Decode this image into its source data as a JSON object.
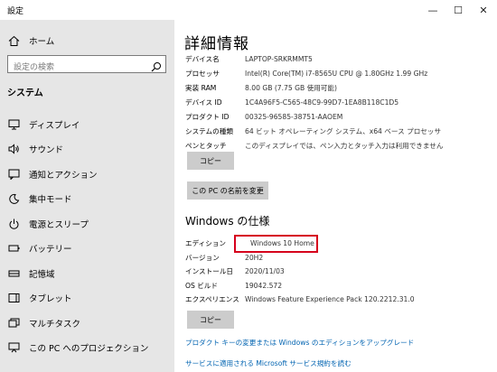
{
  "window": {
    "title": "設定",
    "minimize_glyph": "—",
    "maximize_glyph": "☐",
    "close_glyph": "✕"
  },
  "sidebar": {
    "home_label": "ホーム",
    "search_placeholder": "設定の検索",
    "section_title": "システム",
    "items": [
      {
        "label": "ディスプレイ",
        "icon": "display-icon"
      },
      {
        "label": "サウンド",
        "icon": "sound-icon"
      },
      {
        "label": "通知とアクション",
        "icon": "notification-icon"
      },
      {
        "label": "集中モード",
        "icon": "moon-icon"
      },
      {
        "label": "電源とスリープ",
        "icon": "power-icon"
      },
      {
        "label": "バッテリー",
        "icon": "battery-icon"
      },
      {
        "label": "記憶域",
        "icon": "storage-icon"
      },
      {
        "label": "タブレット",
        "icon": "tablet-icon"
      },
      {
        "label": "マルチタスク",
        "icon": "multitask-icon"
      },
      {
        "label": "この PC へのプロジェクション",
        "icon": "projection-icon"
      }
    ]
  },
  "main": {
    "title": "詳細情報",
    "device_specs": [
      {
        "label": "デバイス名",
        "value": "LAPTOP-SRKRMMT5"
      },
      {
        "label": "プロセッサ",
        "value": "Intel(R) Core(TM) i7-8565U CPU @ 1.80GHz   1.99 GHz"
      },
      {
        "label": "実装 RAM",
        "value": "8.00 GB (7.75 GB 使用可能)"
      },
      {
        "label": "デバイス ID",
        "value": "1C4A96F5-C565-48C9-99D7-1EA8B118C1D5"
      },
      {
        "label": "プロダクト ID",
        "value": "00325-96585-38751-AAOEM"
      },
      {
        "label": "システムの種類",
        "value": "64 ビット オペレーティング システム、x64 ベース プロセッサ"
      },
      {
        "label": "ペンとタッチ",
        "value": "このディスプレイでは、ペン入力とタッチ入力は利用できません"
      }
    ],
    "copy_button": "コピー",
    "rename_button": "この PC の名前を変更",
    "windows_title": "Windows の仕様",
    "windows_specs": [
      {
        "label": "エディション",
        "value": "Windows 10 Home"
      },
      {
        "label": "バージョン",
        "value": "20H2"
      },
      {
        "label": "インストール日",
        "value": "2020/11/03"
      },
      {
        "label": "OS ビルド",
        "value": "19042.572"
      },
      {
        "label": "エクスペリエンス",
        "value": "Windows Feature Experience Pack 120.2212.31.0"
      }
    ],
    "copy_button_2": "コピー",
    "link_upgrade": "プロダクト キーの変更または Windows のエディションをアップグレード",
    "link_terms": "サービスに適用される Microsoft サービス規約を読む",
    "highlight_color": "#d6001c",
    "link_color": "#0063b1"
  }
}
